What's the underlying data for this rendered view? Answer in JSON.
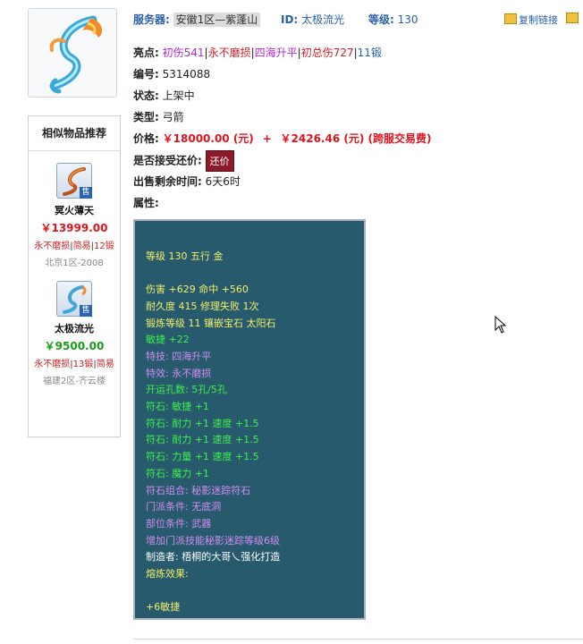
{
  "header": {
    "server_label": "服务器:",
    "server_value": "安徽1区—紫蓬山",
    "id_label": "ID:",
    "id_value": "太极流光",
    "level_label": "等级:",
    "level_value": "130",
    "copy_link": "复制链接"
  },
  "info": {
    "highlights_label": "亮点:",
    "highlights": [
      "初伤541",
      "永不磨损",
      "四海升平",
      "初总伤727",
      "11锻"
    ],
    "code_label": "编号:",
    "code_value": "5314088",
    "status_label": "状态:",
    "status_value": "上架中",
    "type_label": "类型:",
    "type_value": "弓箭",
    "price_label": "价格:",
    "price_value": "￥18000.00 (元)",
    "price_plus": "+",
    "fee_value": "￥2426.46 (元) (跨服交易费)",
    "counter_label": "是否接受还价:",
    "counter_button": "还价",
    "remain_label": "出售剩余时间:",
    "remain_value": "6天6时",
    "attr_label": "属性:"
  },
  "sidebar": {
    "title": "相似物品推荐",
    "items": [
      {
        "name": "冥火薄天",
        "price": "￥13999.00",
        "tags": [
          "永不磨损",
          "简易",
          "12锻"
        ],
        "server": "北京1区-2008",
        "sale": "售"
      },
      {
        "name": "太极流光",
        "price": "￥9500.00",
        "tags": [
          "永不磨损",
          "13锻",
          "简易"
        ],
        "server": "福建2区-齐云楼",
        "sale": "售"
      }
    ]
  },
  "attributes": [
    {
      "text": "",
      "color": "yellow"
    },
    {
      "text": "等级 130  五行 金",
      "color": "yellow"
    },
    {
      "text": "",
      "color": "yellow"
    },
    {
      "text": "伤害 +629 命中 +560",
      "color": "yellow"
    },
    {
      "text": "耐久度 415  修理失败 1次",
      "color": "yellow"
    },
    {
      "text": "锻炼等级 11  镶嵌宝石 太阳石",
      "color": "yellow"
    },
    {
      "text": "敏捷 +22",
      "color": "green"
    },
    {
      "text": "特技: 四海升平",
      "color": "purple"
    },
    {
      "text": "特效: 永不磨损",
      "color": "purple"
    },
    {
      "text": "开运孔数: 5孔/5孔",
      "color": "green"
    },
    {
      "text": "符石: 敏捷 +1",
      "color": "green"
    },
    {
      "text": "符石: 耐力 +1 速度 +1.5",
      "color": "green"
    },
    {
      "text": "符石: 耐力 +1 速度 +1.5",
      "color": "green"
    },
    {
      "text": "符石: 力量 +1 速度 +1.5",
      "color": "green"
    },
    {
      "text": "符石: 魔力 +1",
      "color": "green"
    },
    {
      "text": "符石组合: 秘影迷踪符石",
      "color": "purple"
    },
    {
      "text": "门派条件: 无底洞",
      "color": "purple"
    },
    {
      "text": "部位条件: 武器",
      "color": "purple"
    },
    {
      "text": "增加门派技能秘影迷踪等级6级",
      "color": "purple"
    },
    {
      "text": "制造者: 梧桐的大哥乀强化打造",
      "color": "white"
    },
    {
      "text": "熔炼效果:",
      "color": "yellow"
    },
    {
      "text": "",
      "color": "yellow"
    },
    {
      "text": "+6敏捷",
      "color": "yellow"
    }
  ],
  "colors": {
    "attr_bg": "#275a6c",
    "yellow": "#f4f06a",
    "green": "#3ff04a",
    "purple": "#d28cf2",
    "price_red": "#e0141e",
    "link_blue": "#2b5fa5"
  }
}
